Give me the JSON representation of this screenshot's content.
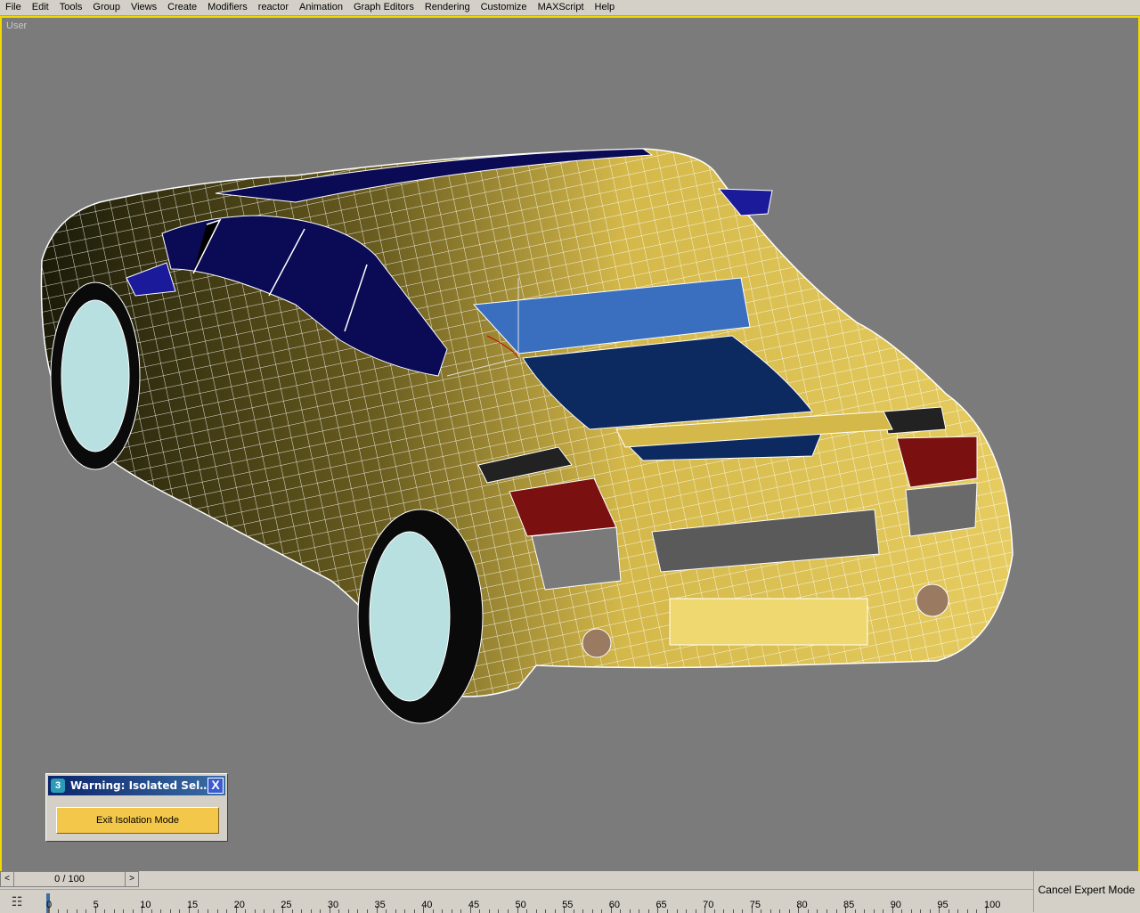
{
  "menu": [
    "File",
    "Edit",
    "Tools",
    "Group",
    "Views",
    "Create",
    "Modifiers",
    "reactor",
    "Animation",
    "Graph Editors",
    "Rendering",
    "Customize",
    "MAXScript",
    "Help"
  ],
  "viewport": {
    "label": "User"
  },
  "dialog": {
    "icon": "3ds-max-app-icon",
    "title": "Warning: Isolated Sel…",
    "close_label": "X",
    "exit_button": "Exit Isolation Mode"
  },
  "time_slider": {
    "prev": "<",
    "next": ">",
    "value": "0 / 100",
    "current_frame": 0,
    "total_frames": 100
  },
  "track": {
    "icon": "key-filter-icon",
    "labels": [
      "0",
      "5",
      "10",
      "15",
      "20",
      "25",
      "30",
      "35",
      "40",
      "45",
      "50",
      "55",
      "60",
      "65",
      "70",
      "75",
      "80",
      "85",
      "90",
      "95",
      "100"
    ]
  },
  "status": {
    "cancel_expert": "Cancel Expert Mode"
  },
  "colors": {
    "viewport_bg": "#7b7b7b",
    "active_border": "#f0d800",
    "car_body": "#d4b84a",
    "glass": "#0a0a5a",
    "taillight": "#8b1a1a"
  }
}
